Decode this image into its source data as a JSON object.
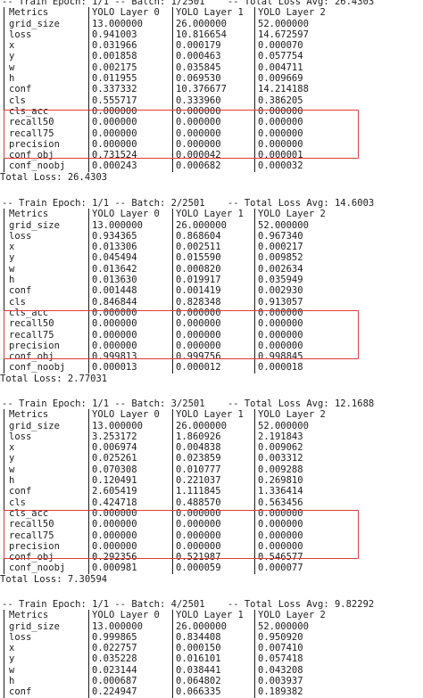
{
  "blocks": [
    {
      "header": "-- Train Epoch: 1/1 -- Batch: 1/2501    -- Total Loss Avg: 26.4303",
      "columns": [
        "Metrics",
        "YOLO Layer 0",
        "YOLO Layer 1",
        "YOLO Layer 2"
      ],
      "rows": [
        [
          "grid_size",
          "13.000000",
          "26.000000",
          "52.000000"
        ],
        [
          "loss",
          "0.941003",
          "10.816654",
          "14.672597"
        ],
        [
          "x",
          "0.031966",
          "0.000179",
          "0.000070"
        ],
        [
          "y",
          "0.001858",
          "0.000463",
          "0.057754"
        ],
        [
          "w",
          "0.002175",
          "0.035845",
          "0.004711"
        ],
        [
          "h",
          "0.011955",
          "0.069530",
          "0.009669"
        ],
        [
          "conf",
          "0.337332",
          "10.376677",
          "14.214188"
        ],
        [
          "cls",
          "0.555717",
          "0.333960",
          "0.386205"
        ],
        [
          "cls_acc",
          "0.000000",
          "0.000000",
          "0.000000"
        ],
        [
          "recall50",
          "0.000000",
          "0.000000",
          "0.000000"
        ],
        [
          "recall75",
          "0.000000",
          "0.000000",
          "0.000000"
        ],
        [
          "precision",
          "0.000000",
          "0.000000",
          "0.000000"
        ],
        [
          "conf_obj",
          "0.731524",
          "0.000042",
          "0.000001"
        ],
        [
          "conf_noobj",
          "0.000243",
          "0.000682",
          "0.000032"
        ]
      ],
      "total": "Total Loss: 26.4303"
    },
    {
      "header": "-- Train Epoch: 1/1 -- Batch: 2/2501    -- Total Loss Avg: 14.6003",
      "columns": [
        "Metrics",
        "YOLO Layer 0",
        "YOLO Layer 1",
        "YOLO Layer 2"
      ],
      "rows": [
        [
          "grid_size",
          "13.000000",
          "26.000000",
          "52.000000"
        ],
        [
          "loss",
          "0.934365",
          "0.868604",
          "0.967340"
        ],
        [
          "x",
          "0.013306",
          "0.002511",
          "0.000217"
        ],
        [
          "y",
          "0.045494",
          "0.015590",
          "0.009852"
        ],
        [
          "w",
          "0.013642",
          "0.000820",
          "0.002634"
        ],
        [
          "h",
          "0.013630",
          "0.019917",
          "0.035949"
        ],
        [
          "conf",
          "0.001448",
          "0.001419",
          "0.002930"
        ],
        [
          "cls",
          "0.846844",
          "0.828348",
          "0.913057"
        ],
        [
          "cls_acc",
          "0.000000",
          "0.000000",
          "0.000000"
        ],
        [
          "recall50",
          "0.000000",
          "0.000000",
          "0.000000"
        ],
        [
          "recall75",
          "0.000000",
          "0.000000",
          "0.000000"
        ],
        [
          "precision",
          "0.000000",
          "0.000000",
          "0.000000"
        ],
        [
          "conf_obj",
          "0.999813",
          "0.999756",
          "0.998845"
        ],
        [
          "conf_noobj",
          "0.000013",
          "0.000012",
          "0.000018"
        ]
      ],
      "total": "Total Loss: 2.77031"
    },
    {
      "header": "-- Train Epoch: 1/1 -- Batch: 3/2501    -- Total Loss Avg: 12.1688",
      "columns": [
        "Metrics",
        "YOLO Layer 0",
        "YOLO Layer 1",
        "YOLO Layer 2"
      ],
      "rows": [
        [
          "grid_size",
          "13.000000",
          "26.000000",
          "52.000000"
        ],
        [
          "loss",
          "3.253172",
          "1.860926",
          "2.191843"
        ],
        [
          "x",
          "0.006974",
          "0.004838",
          "0.009062"
        ],
        [
          "y",
          "0.025261",
          "0.023859",
          "0.003312"
        ],
        [
          "w",
          "0.070308",
          "0.010777",
          "0.009288"
        ],
        [
          "h",
          "0.120491",
          "0.221037",
          "0.269810"
        ],
        [
          "conf",
          "2.605419",
          "1.111845",
          "1.336414"
        ],
        [
          "cls",
          "0.424718",
          "0.488570",
          "0.563456"
        ],
        [
          "cls_acc",
          "0.000000",
          "0.000000",
          "0.000000"
        ],
        [
          "recall50",
          "0.000000",
          "0.000000",
          "0.000000"
        ],
        [
          "recall75",
          "0.000000",
          "0.000000",
          "0.000000"
        ],
        [
          "precision",
          "0.000000",
          "0.000000",
          "0.000000"
        ],
        [
          "conf_obj",
          "0.292356",
          "0.521987",
          "0.546577"
        ],
        [
          "conf_noobj",
          "0.000981",
          "0.000059",
          "0.000077"
        ]
      ],
      "total": "Total Loss: 7.30594"
    },
    {
      "header": "-- Train Epoch: 1/1 -- Batch: 4/2501    -- Total Loss Avg: 9.82292",
      "columns": [
        "Metrics",
        "YOLO Layer 0",
        "YOLO Layer 1",
        "YOLO Layer 2"
      ],
      "rows": [
        [
          "grid_size",
          "13.000000",
          "26.000000",
          "52.000000"
        ],
        [
          "loss",
          "0.999865",
          "0.834408",
          "0.950920"
        ],
        [
          "x",
          "0.022757",
          "0.000150",
          "0.007410"
        ],
        [
          "y",
          "0.035228",
          "0.016101",
          "0.057418"
        ],
        [
          "w",
          "0.023144",
          "0.038441",
          "0.043208"
        ],
        [
          "h",
          "0.000687",
          "0.064802",
          "0.003937"
        ],
        [
          "conf",
          "0.224947",
          "0.066335",
          "0.189382"
        ]
      ],
      "total": ""
    }
  ],
  "highlight_color": "#e23a3a"
}
